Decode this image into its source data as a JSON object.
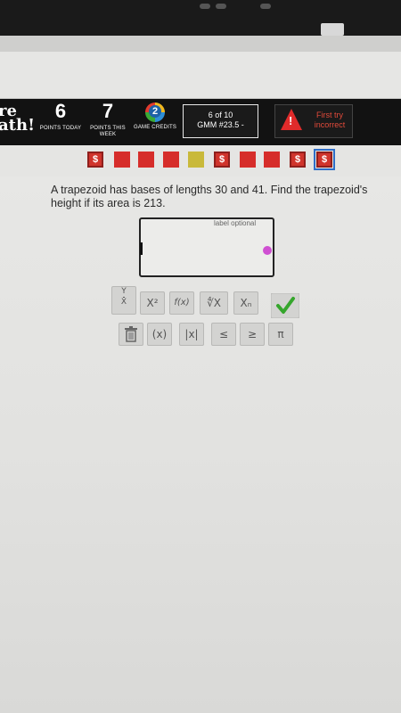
{
  "header": {
    "logo_line1": "re",
    "logo_line2": "ath!",
    "points_today": {
      "value": "6",
      "label": "POINTS TODAY"
    },
    "points_week": {
      "value": "7",
      "label": "POINTS THIS WEEK"
    },
    "game_credits": {
      "value": "2",
      "label": "GAME CREDITS"
    },
    "progress": {
      "line1": "6 of 10",
      "line2": "GMM #23.5 -"
    },
    "warning": {
      "icon": "!",
      "line1": "First try",
      "line2": "incorrect"
    }
  },
  "tiles": [
    {
      "type": "dollar",
      "symbol": "$"
    },
    {
      "type": "red"
    },
    {
      "type": "red"
    },
    {
      "type": "red"
    },
    {
      "type": "yellow"
    },
    {
      "type": "dollar",
      "symbol": "$"
    },
    {
      "type": "red"
    },
    {
      "type": "red"
    },
    {
      "type": "dollar",
      "symbol": "$"
    },
    {
      "type": "dollar",
      "symbol": "$",
      "current": true
    }
  ],
  "question": {
    "text": "A trapezoid has bases of lengths 30 and 41. Find the trapezoid's height if its area is 213."
  },
  "answer": {
    "label": "label optional",
    "value": ""
  },
  "toolbar": {
    "fraction_top": "Y",
    "fraction_bottom": "X",
    "power": "X²",
    "function": "f(x)",
    "root": "∜X",
    "subscript": "Xₙ",
    "submit_icon": "checkmark-icon",
    "trash_icon": "trash-icon",
    "parens": "(x)",
    "abs": "|x|",
    "leq": "≤",
    "geq": "≥",
    "pi": "π"
  },
  "colors": {
    "header_bg": "#121212",
    "tile_red": "#d62d2a",
    "tile_yellow": "#c9b93a",
    "check_green": "#35a62c",
    "warning_red": "#e02b2b",
    "cursor_dot": "#cf4fd2"
  }
}
